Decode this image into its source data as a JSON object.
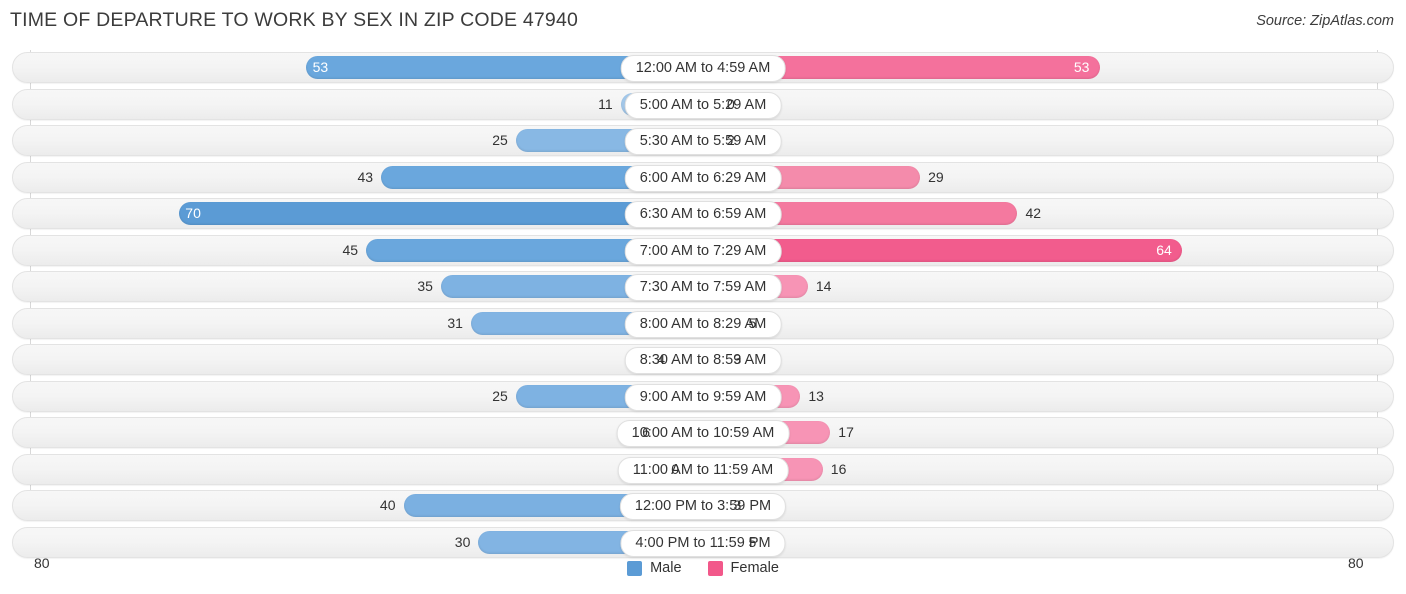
{
  "header": {
    "title": "TIME OF DEPARTURE TO WORK BY SEX IN ZIP CODE 47940",
    "source": "Source: ZipAtlas.com"
  },
  "footer": {
    "axis_left": "80",
    "axis_right": "80",
    "legend": [
      {
        "label": "Male",
        "color": "#5b9bd5"
      },
      {
        "label": "Female",
        "color": "#f2588a"
      }
    ]
  },
  "chart_data": {
    "type": "bar",
    "subtype": "diverging-bidirectional",
    "title": "TIME OF DEPARTURE TO WORK BY SEX IN ZIP CODE 47940",
    "xlabel": "",
    "ylabel": "",
    "xlim": [
      80,
      80
    ],
    "axis_max": 80,
    "grid": true,
    "legend_position": "bottom-center",
    "categories": [
      "12:00 AM to 4:59 AM",
      "5:00 AM to 5:29 AM",
      "5:30 AM to 5:59 AM",
      "6:00 AM to 6:29 AM",
      "6:30 AM to 6:59 AM",
      "7:00 AM to 7:29 AM",
      "7:30 AM to 7:59 AM",
      "8:00 AM to 8:29 AM",
      "8:30 AM to 8:59 AM",
      "9:00 AM to 9:59 AM",
      "10:00 AM to 10:59 AM",
      "11:00 AM to 11:59 AM",
      "12:00 PM to 3:59 PM",
      "4:00 PM to 11:59 PM"
    ],
    "series": [
      {
        "name": "Male",
        "direction": "left",
        "values": [
          53,
          11,
          25,
          43,
          70,
          45,
          35,
          31,
          4,
          25,
          6,
          0,
          40,
          30
        ]
      },
      {
        "name": "Female",
        "direction": "right",
        "values": [
          53,
          0,
          2,
          29,
          42,
          64,
          14,
          5,
          3,
          13,
          17,
          16,
          3,
          5
        ]
      }
    ]
  },
  "rows": [
    {
      "label": "12:00 AM to 4:59 AM",
      "male": "53",
      "female": "53",
      "male_color": "#6aa7dd",
      "female_color": "#f4719c",
      "male_inside": true,
      "female_inside": true
    },
    {
      "label": "5:00 AM to 5:29 AM",
      "male": "11",
      "female": "0",
      "male_color": "#a3c8ea",
      "female_color": "#f9a8c2",
      "male_inside": false,
      "female_inside": false
    },
    {
      "label": "5:30 AM to 5:59 AM",
      "male": "25",
      "female": "2",
      "male_color": "#88b8e4",
      "female_color": "#f9a8c2",
      "male_inside": false,
      "female_inside": false
    },
    {
      "label": "6:00 AM to 6:29 AM",
      "male": "43",
      "female": "29",
      "male_color": "#6aa7dd",
      "female_color": "#f48bab",
      "male_inside": false,
      "female_inside": false
    },
    {
      "label": "6:30 AM to 6:59 AM",
      "male": "70",
      "female": "42",
      "male_color": "#5b9bd5",
      "female_color": "#f4799f",
      "male_inside": true,
      "female_inside": false
    },
    {
      "label": "7:00 AM to 7:29 AM",
      "male": "45",
      "female": "64",
      "male_color": "#6aa7dd",
      "female_color": "#f25c8d",
      "male_inside": false,
      "female_inside": true
    },
    {
      "label": "7:30 AM to 7:59 AM",
      "male": "35",
      "female": "14",
      "male_color": "#7eb2e2",
      "female_color": "#f794b5",
      "male_inside": false,
      "female_inside": false
    },
    {
      "label": "8:00 AM to 8:29 AM",
      "male": "31",
      "female": "5",
      "male_color": "#82b4e3",
      "female_color": "#f9a0bd",
      "male_inside": false,
      "female_inside": false
    },
    {
      "label": "8:30 AM to 8:59 AM",
      "male": "4",
      "female": "3",
      "male_color": "#a3c8ea",
      "female_color": "#f9a8c2",
      "male_inside": false,
      "female_inside": false
    },
    {
      "label": "9:00 AM to 9:59 AM",
      "male": "25",
      "female": "13",
      "male_color": "#7eb2e2",
      "female_color": "#f794b5",
      "male_inside": false,
      "female_inside": false
    },
    {
      "label": "10:00 AM to 10:59 AM",
      "male": "6",
      "female": "17",
      "male_color": "#a3c8ea",
      "female_color": "#f794b5",
      "male_inside": false,
      "female_inside": false
    },
    {
      "label": "11:00 AM to 11:59 AM",
      "male": "0",
      "female": "16",
      "male_color": "#a8cbec",
      "female_color": "#f794b5",
      "male_inside": false,
      "female_inside": false
    },
    {
      "label": "12:00 PM to 3:59 PM",
      "male": "40",
      "female": "3",
      "male_color": "#7bb0e1",
      "female_color": "#f9a0bd",
      "male_inside": false,
      "female_inside": false
    },
    {
      "label": "4:00 PM to 11:59 PM",
      "male": "30",
      "female": "5",
      "male_color": "#82b4e3",
      "female_color": "#f9a0bd",
      "male_inside": false,
      "female_inside": false
    }
  ]
}
